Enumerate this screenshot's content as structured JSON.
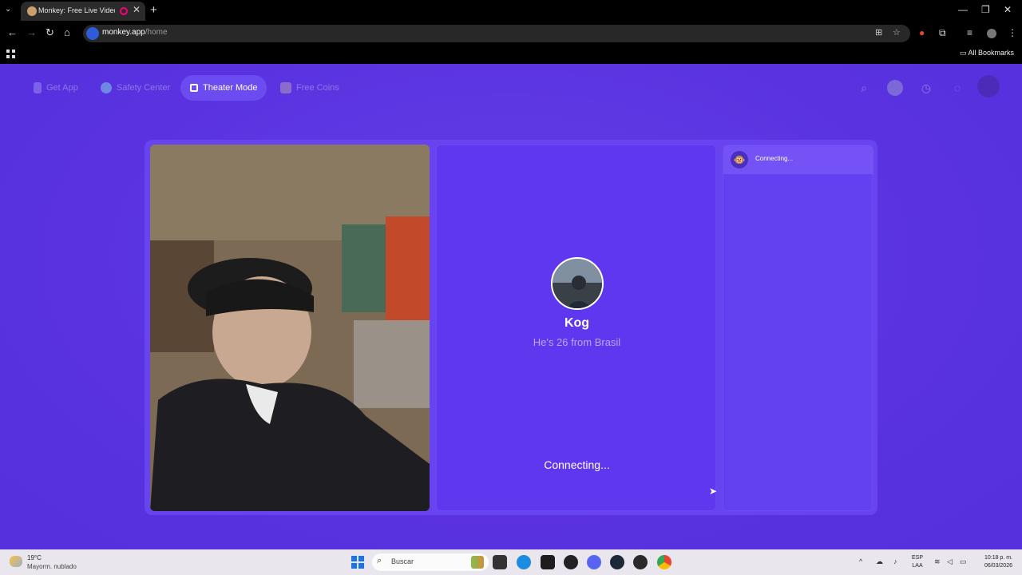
{
  "browser": {
    "tab_title": "Monkey: Free Live Video Ch",
    "new_tab": "+",
    "url_host": "monkey.app",
    "url_path": "/home",
    "all_bookmarks": "All Bookmarks"
  },
  "site_nav": {
    "get_app": "Get App",
    "safety_center": "Safety Center",
    "theater_mode": "Theater Mode",
    "free_coins": "Free Coins"
  },
  "partner": {
    "name": "Kog",
    "subtitle": "He's 26 from Brasil",
    "status": "Connecting..."
  },
  "chat": {
    "status": "Connecting..."
  },
  "taskbar": {
    "temp": "19°C",
    "weather": "Mayorm. nublado",
    "search": "Buscar",
    "lang1": "ESP",
    "lang2": "LAA",
    "time": "10:18 p. m.",
    "date": "06/03/2026"
  },
  "colors": {
    "page_bg": "#5a30e0",
    "accent": "#6c4bf0"
  }
}
